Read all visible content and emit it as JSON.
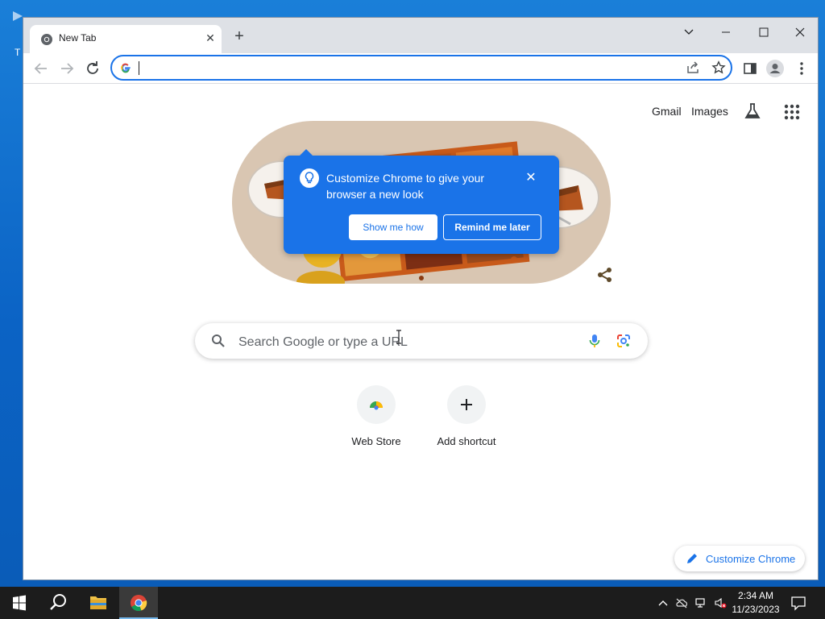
{
  "desktop": {
    "icon_letter": "T"
  },
  "browser": {
    "tab": {
      "title": "New Tab"
    },
    "omnibox": {
      "value": "",
      "placeholder": ""
    }
  },
  "page": {
    "header_links": {
      "gmail": "Gmail",
      "images": "Images"
    },
    "search": {
      "placeholder": "Search Google or type a URL"
    },
    "shortcuts": [
      {
        "label": "Web Store"
      },
      {
        "label": "Add shortcut"
      }
    ],
    "customize_label": "Customize Chrome"
  },
  "promo": {
    "text": "Customize Chrome to give your browser a new look",
    "show_me_how": "Show me how",
    "remind_me_later": "Remind me later"
  },
  "taskbar": {
    "time": "2:34 AM",
    "date": "11/23/2023"
  },
  "colors": {
    "accent": "#1a73e8",
    "taskbar": "#1c1c1c",
    "desktop": "#0b63c5"
  }
}
